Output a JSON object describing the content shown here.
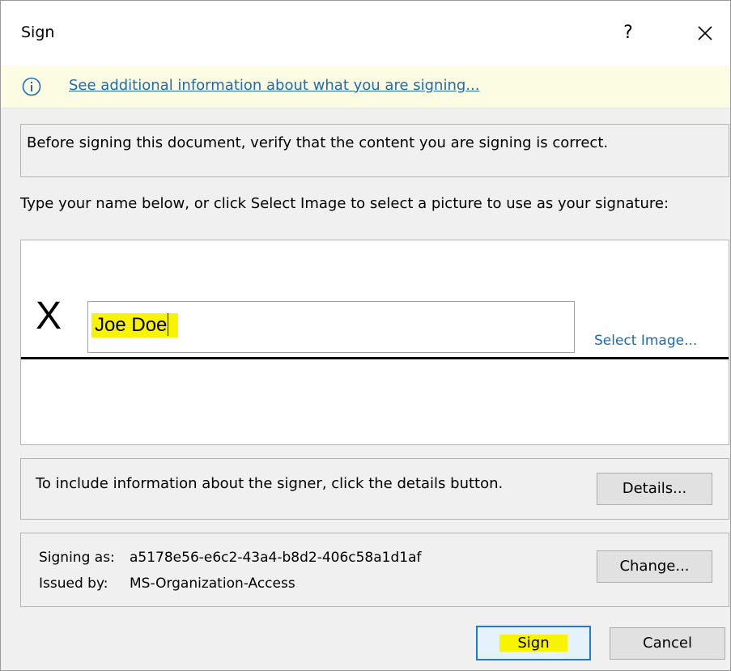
{
  "dialog": {
    "title": "Sign",
    "help_label": "?",
    "info_link": "See additional information about what you are signing...",
    "verify_text": "Before signing this document, verify that the content you are signing is correct.",
    "instruction_text": "Type your name below, or click Select Image to select a picture to use as your signature:",
    "signature_x": "X",
    "signature_value": "Joe Doe",
    "select_image_label": "Select Image...",
    "details_text": "To include information about the signer, click the details button.",
    "details_button": "Details...",
    "signing_as_label": "Signing as:",
    "signing_as_value": "a5178e56-e6c2-43a4-b8d2-406c58a1d1af",
    "issued_by_label": "Issued by:",
    "issued_by_value": "MS-Organization-Access",
    "change_button": "Change...",
    "sign_button": "Sign",
    "cancel_button": "Cancel"
  },
  "icons": {
    "info": "info-icon",
    "close": "close-icon"
  },
  "colors": {
    "link": "#1b6bb5",
    "infobar": "#fcfce2",
    "highlight": "#f8f400",
    "default_button_border": "#1e7bd4"
  }
}
